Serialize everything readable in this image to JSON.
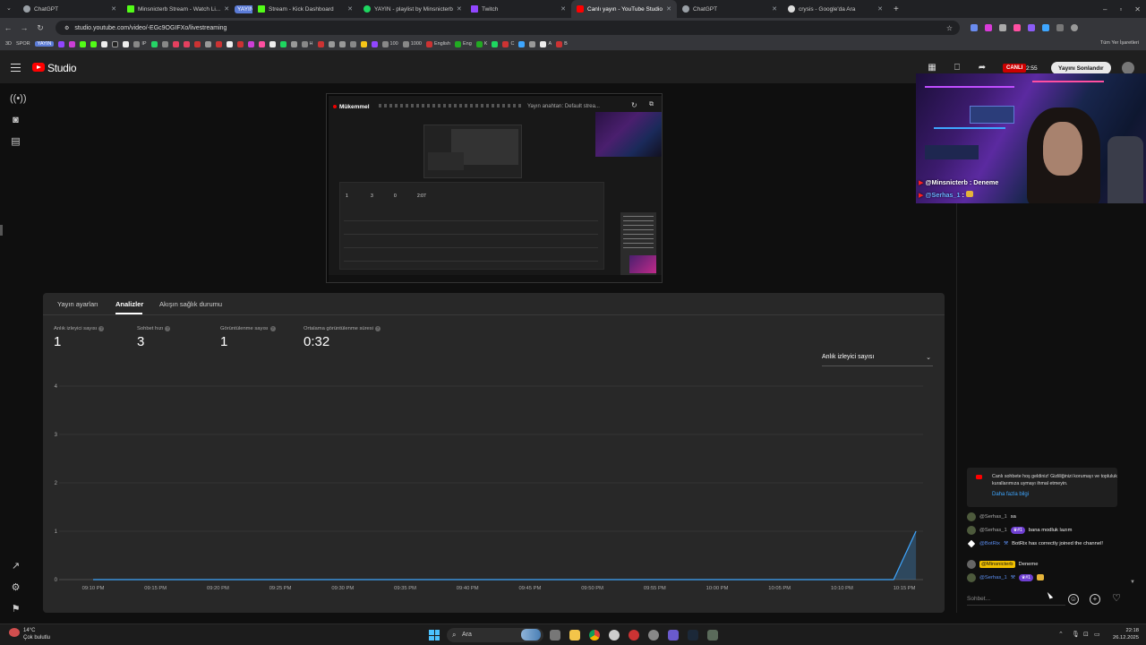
{
  "browser": {
    "tabs": [
      {
        "label": "ChatGPT",
        "color": "#9aa0a6"
      },
      {
        "label": "Minsnicterb Stream - Watch Li...",
        "color": "#53fc18"
      },
      {
        "label": "YAYIN",
        "color": "#5b7bd6",
        "pill": true
      },
      {
        "label": "Stream - Kick Dashboard",
        "color": "#53fc18"
      },
      {
        "label": "YAYIN - playlist by Minsnicterb",
        "color": "#1ed760"
      },
      {
        "label": "Twitch",
        "color": "#9146ff"
      },
      {
        "label": "Canlı yayın - YouTube Studio",
        "color": "#ff0000",
        "active": true
      },
      {
        "label": "ChatGPT",
        "color": "#9aa0a6"
      },
      {
        "label": "crysis - Google'da Ara",
        "color": "#dddddd"
      }
    ],
    "url": "studio.youtube.com/video/-EGc9OGIFXo/livestreaming",
    "bookmarks": [
      "3D",
      "SPOR",
      "YAYIN",
      "IP",
      "H",
      "100",
      "1000",
      "English",
      "Eng",
      "K",
      "C",
      "A",
      "B"
    ],
    "bookmarks_right": "Tüm Yer İşaretleri"
  },
  "studio": {
    "title": "Studio",
    "live_label": "CANLI",
    "live_time": "2:55",
    "end_button": "Yayını Sonlandır"
  },
  "preview": {
    "title": "Mükemmel",
    "search_placeholder": "Yayın anahtarı: Default strea...",
    "mini_stats": [
      "1",
      "3",
      "0",
      "2:07"
    ]
  },
  "tabs": {
    "settings": "Yayın ayarları",
    "analytics": "Analizler",
    "health": "Akışın sağlık durumu"
  },
  "metrics": [
    {
      "label": "Anlık izleyici sayısı",
      "value": "1"
    },
    {
      "label": "Sohbet hızı",
      "value": "3"
    },
    {
      "label": "Görüntülenme sayısı",
      "value": "1"
    },
    {
      "label": "Ortalama görüntülenme süresi",
      "value": "0:32"
    }
  ],
  "metric_dropdown": "Anlık izleyici sayısı",
  "chart_data": {
    "type": "area",
    "x": [
      "09:10 PM",
      "09:15 PM",
      "09:20 PM",
      "09:25 PM",
      "09:30 PM",
      "09:35 PM",
      "09:40 PM",
      "09:45 PM",
      "09:50 PM",
      "09:55 PM",
      "10:00 PM",
      "10:05 PM",
      "10:10 PM",
      "10:15 PM"
    ],
    "ylim": [
      0,
      4
    ],
    "yticks": [
      0,
      1,
      2,
      3,
      4
    ],
    "series": [
      {
        "values": [
          0,
          0,
          0,
          0,
          0,
          0,
          0,
          0,
          0,
          0,
          0,
          0,
          0,
          0,
          1
        ],
        "x_end": "10:16 PM"
      }
    ],
    "grid": true,
    "color": "#3ea6ff"
  },
  "webcam": {
    "chat1_user": "@Minsnicterb",
    "chat1_text": ": Deneme",
    "chat2_user": "@Serhas_1",
    "chat2_text": ":"
  },
  "chat": {
    "welcome": "Canlı sohbete hoş geldiniz! Gizliliğinizi korumayı ve topluluk kurallarımıza uymayı ihmal etmeyin.",
    "welcome_link": "Daha fazla bilgi",
    "messages": [
      {
        "user": "@Serhas_1",
        "text": "sa"
      },
      {
        "user": "@Serhas_1",
        "badge": "#1",
        "text": "bana modluk lazım"
      },
      {
        "user": "@BotRix",
        "text": "BotRix has correctly joined the channel!"
      },
      {
        "user": "@Minsnicterb",
        "text": "Deneme"
      },
      {
        "user": "@Serhas_1",
        "badge": "#1",
        "text": ""
      }
    ],
    "input_placeholder": "Sohbet..."
  },
  "taskbar": {
    "weather_temp": "14°C",
    "weather_desc": "Çok bulutlu",
    "search": "Ara",
    "time": "22:18",
    "date": "26.12.2025"
  }
}
